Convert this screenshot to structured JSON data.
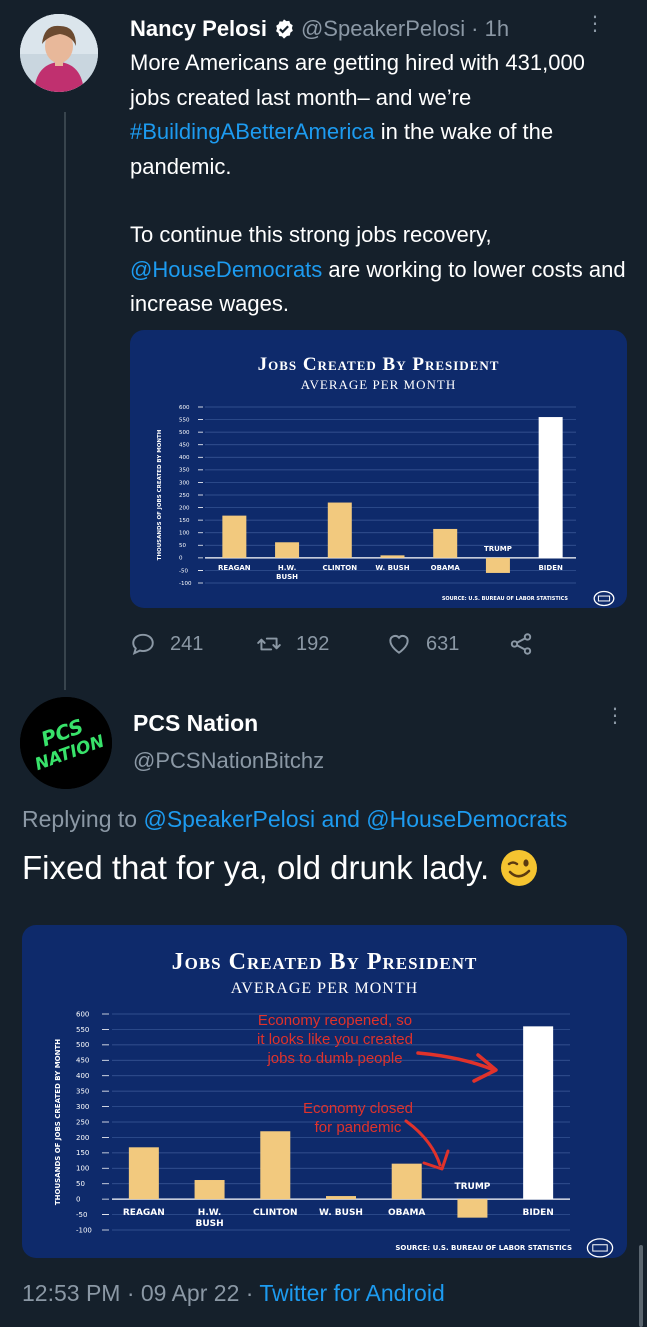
{
  "tweet": {
    "author_name": "Nancy Pelosi",
    "author_handle": "@SpeakerPelosi",
    "time_ago": "· 1h",
    "text_line1": "More Americans are getting hired with 431,000 jobs created last month– and we’re ",
    "hashtag": "#BuildingABetterAmerica",
    "text_line1_end": " in the wake of the pandemic.",
    "text_line2_mention": "@HouseDemocrats",
    "text_line2_pre": "To continue this strong jobs recovery, ",
    "text_line2_end": " are working to lower costs and increase wages.",
    "replies": "241",
    "retweets": "192",
    "likes": "631"
  },
  "reply": {
    "author_name": "PCS Nation",
    "author_handle": "@PCSNationBitchz",
    "avatar_text_top": "PCS",
    "avatar_text_bottom": "NATION",
    "replying_prefix": "Replying to ",
    "replying_mention1": "@SpeakerPelosi",
    "replying_and": " and ",
    "replying_mention2": "@HouseDemocrats",
    "text": "Fixed that for ya, old drunk lady."
  },
  "footer": {
    "timestamp": "12:53 PM · 09 Apr 22 · ",
    "source": "Twitter for Android"
  },
  "colors": {
    "background": "#15202b",
    "link": "#1d9bf0",
    "muted": "#8b98a5",
    "chart_bg": "#0e2a6b",
    "bar": "#f2c97e",
    "bar_biden": "#ffffff",
    "annotation_red": "#e0322b"
  },
  "chart_data": [
    {
      "type": "bar",
      "title": "Jobs Created By President",
      "subtitle": "AVERAGE PER MONTH",
      "ylabel": "THOUSANDS OF JOBS CREATED BY MONTH",
      "yticks": [
        "600",
        "550",
        "500",
        "450",
        "400",
        "350",
        "300",
        "250",
        "200",
        "150",
        "100",
        "50",
        "0",
        "-50",
        "-100"
      ],
      "categories": [
        "REAGAN",
        "H.W.\nBUSH",
        "CLINTON",
        "W. BUSH",
        "OBAMA",
        "TRUMP",
        "BIDEN"
      ],
      "values": [
        168,
        62,
        220,
        10,
        115,
        -60,
        560
      ],
      "ylim": [
        -100,
        600
      ],
      "source": "SOURCE: U.S. BUREAU OF LABOR STATISTICS",
      "grid": true
    },
    {
      "type": "bar",
      "title": "Jobs Created By President",
      "subtitle": "AVERAGE PER MONTH",
      "ylabel": "THOUSANDS OF JOBS CREATED BY MONTH",
      "yticks": [
        "600",
        "550",
        "500",
        "450",
        "400",
        "350",
        "300",
        "250",
        "200",
        "150",
        "100",
        "50",
        "0",
        "-50",
        "-100"
      ],
      "categories": [
        "REAGAN",
        "H.W.\nBUSH",
        "CLINTON",
        "W. BUSH",
        "OBAMA",
        "TRUMP",
        "BIDEN"
      ],
      "values": [
        168,
        62,
        220,
        10,
        115,
        -60,
        560
      ],
      "ylim": [
        -100,
        600
      ],
      "source": "SOURCE: U.S. BUREAU OF LABOR STATISTICS",
      "grid": true,
      "annotations": [
        "Economy reopened, so\nit looks like you created\njobs to dumb people",
        "Economy closed\nfor pandemic"
      ]
    }
  ]
}
